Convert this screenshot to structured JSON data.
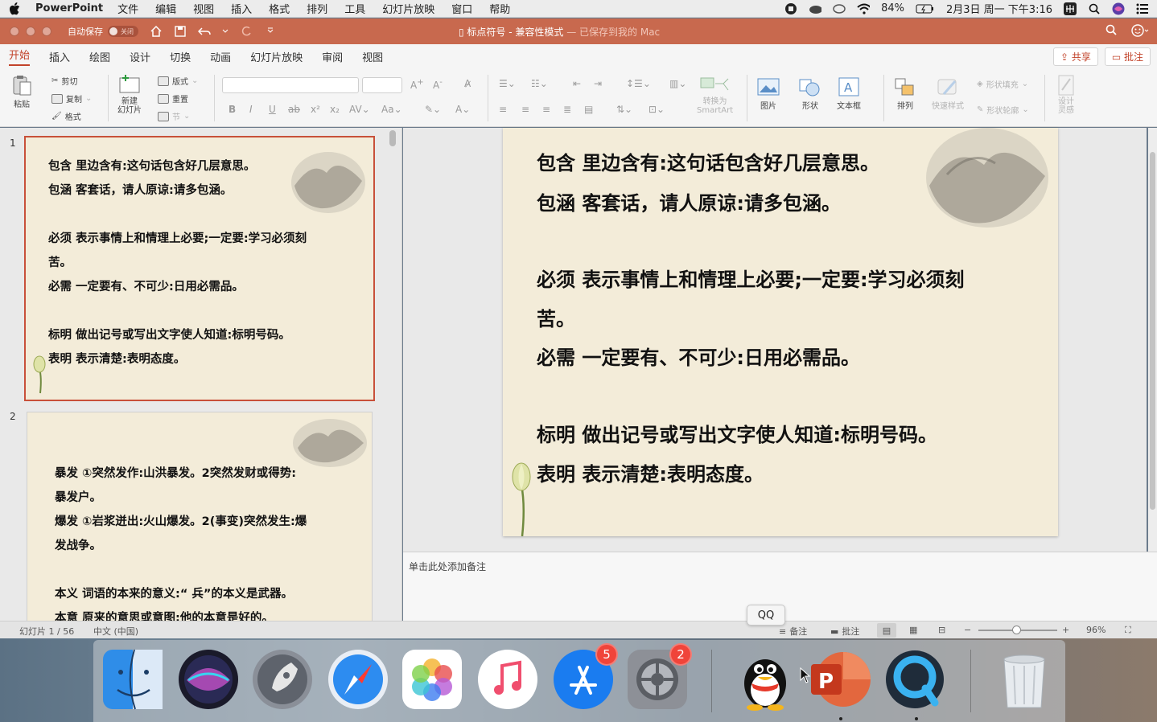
{
  "menubar": {
    "app_name": "PowerPoint",
    "items": [
      "文件",
      "编辑",
      "视图",
      "插入",
      "格式",
      "排列",
      "工具",
      "幻灯片放映",
      "窗口",
      "帮助"
    ],
    "battery": "84%",
    "datetime": "2月3日 周一 下午3:16"
  },
  "titlebar": {
    "autosave_label": "自动保存",
    "autosave_state": "关闭",
    "doc_title": "标点符号 - 兼容性模式",
    "save_status": "— 已保存到我的 Mac"
  },
  "ribbon_tabs": {
    "items": [
      "开始",
      "插入",
      "绘图",
      "设计",
      "切换",
      "动画",
      "幻灯片放映",
      "审阅",
      "视图"
    ],
    "active": "开始",
    "share": "共享",
    "comments": "批注"
  },
  "ribbon": {
    "paste": "粘贴",
    "cut": "剪切",
    "copy": "复制",
    "format": "格式",
    "new_slide": "新建\n幻灯片",
    "layout": "版式",
    "reset": "重置",
    "section": "节",
    "convert_smartart": "转换为\nSmartArt",
    "picture": "图片",
    "shape": "形状",
    "textbox": "文本框",
    "arrange": "排列",
    "quick_styles": "快速样式",
    "shape_fill": "形状填充",
    "shape_outline": "形状轮廓",
    "designer": "设计\n灵感"
  },
  "slides": [
    {
      "number": "1",
      "lines": [
        "包含  里边含有:这句话包含好几层意思。",
        "包涵  客套话，请人原谅:请多包涵。",
        "",
        "必须   表示事情上和情理上必要;一定要:学习必须刻",
        "苦。",
        "必需   一定要有、不可少:日用必需品。",
        "",
        "标明   做出记号或写出文字使人知道:标明号码。",
        "表明    表示清楚:表明态度。"
      ]
    },
    {
      "number": "2",
      "lines": [
        "暴发    ①突然发作:山洪暴发。2突然发财或得势:",
        "暴发户。",
        "爆发    ①岩浆迸出:火山爆发。2(事变)突然发生:爆",
        "发战争。",
        "",
        "本义  词语的本来的意义:“ 兵”的本义是武器。",
        "本意   原来的意思或意图:他的本意是好的。"
      ]
    }
  ],
  "notes_placeholder": "单击此处添加备注",
  "statusbar": {
    "slide_info": "幻灯片 1 / 56",
    "language": "中文 (中国)",
    "notes": "备注",
    "comments": "批注",
    "zoom": "96%"
  },
  "tooltip": "QQ",
  "dock": {
    "appstore_badge": "5",
    "settings_badge": "2"
  },
  "colors": {
    "titlebar": "#c8694e",
    "accent": "#c2432a",
    "slide_bg": "#f3ecd9"
  }
}
